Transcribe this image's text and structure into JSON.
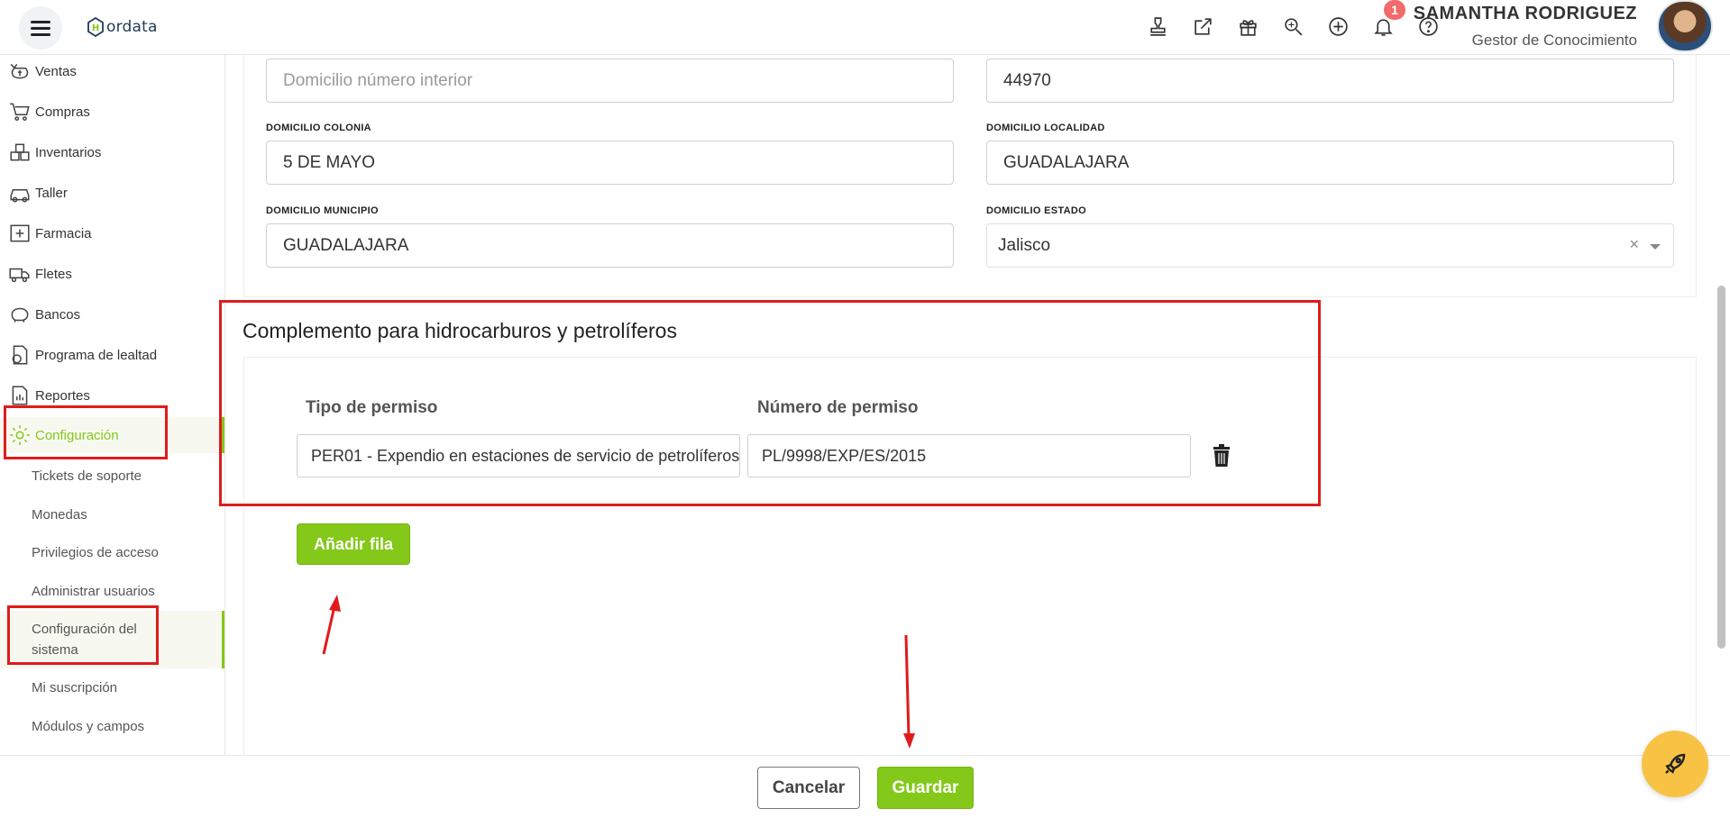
{
  "app": {
    "logo_text": "ordata",
    "logo_letter": "H"
  },
  "header": {
    "notification_count": "1",
    "user_name": "SAMANTHA RODRIGUEZ",
    "user_role": "Gestor de Conocimiento"
  },
  "sidebar": {
    "items": [
      {
        "label": "Ventas",
        "icon": "money-bag-icon"
      },
      {
        "label": "Compras",
        "icon": "cart-icon"
      },
      {
        "label": "Inventarios",
        "icon": "boxes-icon"
      },
      {
        "label": "Taller",
        "icon": "car-icon"
      },
      {
        "label": "Farmacia",
        "icon": "medical-kit-icon"
      },
      {
        "label": "Fletes",
        "icon": "truck-icon"
      },
      {
        "label": "Bancos",
        "icon": "piggy-bank-icon"
      },
      {
        "label": "Programa de lealtad",
        "icon": "loyalty-icon"
      },
      {
        "label": "Reportes",
        "icon": "report-icon"
      },
      {
        "label": "Configuración",
        "icon": "gear-icon",
        "active": true
      }
    ],
    "sub_items": [
      "Tickets de soporte",
      "Monedas",
      "Privilegios de acceso",
      "Administrar usuarios",
      "Configuración del sistema",
      "Mi suscripción",
      "Módulos y campos"
    ],
    "active_sub_item": "Configuración del sistema"
  },
  "form": {
    "numero_interior": {
      "placeholder": "Domicilio número interior"
    },
    "codigo_postal": {
      "value": "44970"
    },
    "colonia": {
      "label": "DOMICILIO COLONIA",
      "value": "5 DE MAYO"
    },
    "localidad": {
      "label": "DOMICILIO LOCALIDAD",
      "value": "GUADALAJARA"
    },
    "municipio": {
      "label": "DOMICILIO MUNICIPIO",
      "value": "GUADALAJARA"
    },
    "estado": {
      "label": "DOMICILIO ESTADO",
      "value": "Jalisco",
      "clear": "×"
    }
  },
  "complemento": {
    "title": "Complemento para hidrocarburos y petrolíferos",
    "col_tipo": "Tipo de permiso",
    "col_numero": "Número de permiso",
    "rows": [
      {
        "tipo": "PER01 - Expendio en estaciones de servicio de petrolíferos",
        "numero": "PL/9998/EXP/ES/2015"
      }
    ],
    "add_row_label": "Añadir fila"
  },
  "footer": {
    "cancel_label": "Cancelar",
    "save_label": "Guardar"
  },
  "colors": {
    "accent": "#84c81a",
    "annotation": "#e01b1b",
    "rocket": "#f8c344",
    "badge": "#f26b6b"
  }
}
